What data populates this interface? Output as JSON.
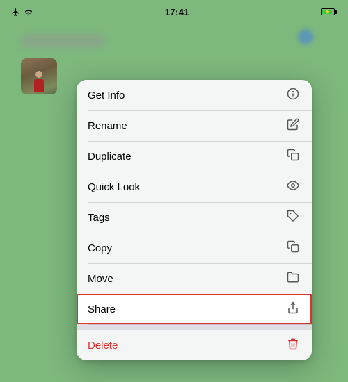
{
  "statusBar": {
    "time": "17:41"
  },
  "contextMenu": {
    "items": [
      {
        "id": "get-info",
        "label": "Get Info",
        "icon": "info"
      },
      {
        "id": "rename",
        "label": "Rename",
        "icon": "pencil"
      },
      {
        "id": "duplicate",
        "label": "Duplicate",
        "icon": "duplicate"
      },
      {
        "id": "quick-look",
        "label": "Quick Look",
        "icon": "eye"
      },
      {
        "id": "tags",
        "label": "Tags",
        "icon": "tag"
      },
      {
        "id": "copy",
        "label": "Copy",
        "icon": "copy"
      },
      {
        "id": "move",
        "label": "Move",
        "icon": "folder"
      },
      {
        "id": "share",
        "label": "Share",
        "icon": "share"
      }
    ],
    "destructiveItem": {
      "id": "delete",
      "label": "Delete",
      "icon": "trash"
    }
  }
}
